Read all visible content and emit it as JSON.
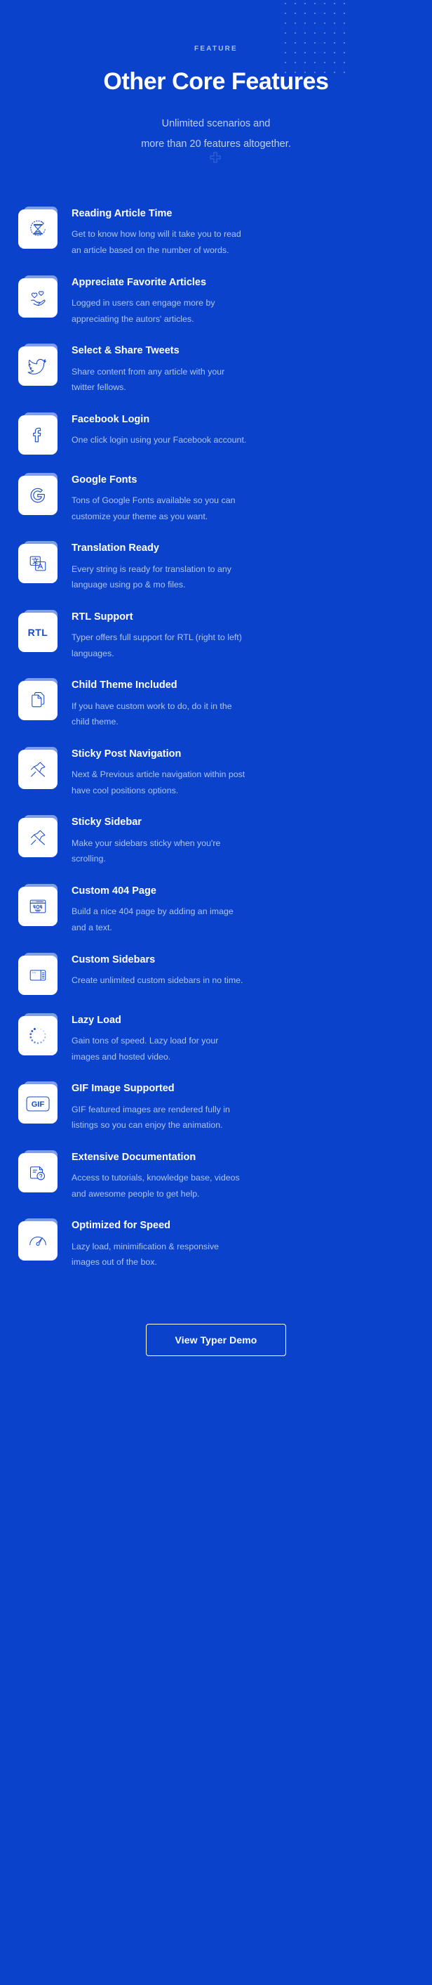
{
  "theme": {
    "background": "#0A42CC",
    "card_background": "#FFFFFF",
    "icon_color": "#1648C8",
    "title_color": "#FFFFFF",
    "desc_color": "#AFC5F0",
    "tab_color": "#7E9EEA",
    "eyebrow_color": "#A9C0EE"
  },
  "header": {
    "eyebrow": "FEATURE",
    "title": "Other Core Features",
    "subtitle_line1": "Unlimited scenarios and",
    "subtitle_line2": "more than 20 features altogether."
  },
  "features": [
    {
      "icon": "hourglass-clock-icon",
      "title": "Reading Article Time",
      "desc": "Get to know how long will it take you to read an article based on the number of words."
    },
    {
      "icon": "heart-hand-icon",
      "title": "Appreciate Favorite Articles",
      "desc": "Logged in users can engage more by appreciating the autors' articles."
    },
    {
      "icon": "twitter-bird-icon",
      "title": "Select & Share Tweets",
      "desc": "Share content from any article with your twitter fellows."
    },
    {
      "icon": "facebook-icon",
      "title": "Facebook Login",
      "desc": "One click login using your Facebook account."
    },
    {
      "icon": "google-g-icon",
      "title": "Google Fonts",
      "desc": "Tons of Google Fonts available so you can customize your theme as you want."
    },
    {
      "icon": "translate-icon",
      "title": "Translation Ready",
      "desc": " Every string is ready for translation to any language using po & mo files."
    },
    {
      "icon": "rtl-text-icon",
      "title": "RTL Support",
      "desc": "Typer offers full support for RTL (right to left) languages."
    },
    {
      "icon": "documents-copy-icon",
      "title": "Child Theme Included",
      "desc": "If you have custom work to do, do it in the child theme."
    },
    {
      "icon": "pin-arrow-icon",
      "title": "Sticky Post Navigation",
      "desc": "Next & Previous article navigation within post have cool positions options."
    },
    {
      "icon": "pin-arrow-icon",
      "title": "Sticky Sidebar",
      "desc": "Make your sidebars sticky when you're scrolling."
    },
    {
      "icon": "browser-404-icon",
      "title": "Custom 404 Page",
      "desc": "Build a nice 404 page by adding an image and a text."
    },
    {
      "icon": "layout-sidebar-icon",
      "title": "Custom Sidebars",
      "desc": "Create unlimited custom sidebars in no time."
    },
    {
      "icon": "loading-spinner-icon",
      "title": "Lazy Load",
      "desc": "Gain tons of speed. Lazy load for your images and hosted video."
    },
    {
      "icon": "gif-badge-icon",
      "title": "GIF Image Supported",
      "desc": " GIF featured images are rendered fully in listings so you can enjoy the animation."
    },
    {
      "icon": "document-question-icon",
      "title": "Extensive Documentation",
      "desc": "Access to tutorials, knowledge base, videos and awesome people to get help."
    },
    {
      "icon": "speed-gauge-icon",
      "title": "Optimized for Speed",
      "desc": "Lazy load, minimification & responsive images out of the box."
    }
  ],
  "footer": {
    "demo_button": "View Typer Demo"
  }
}
